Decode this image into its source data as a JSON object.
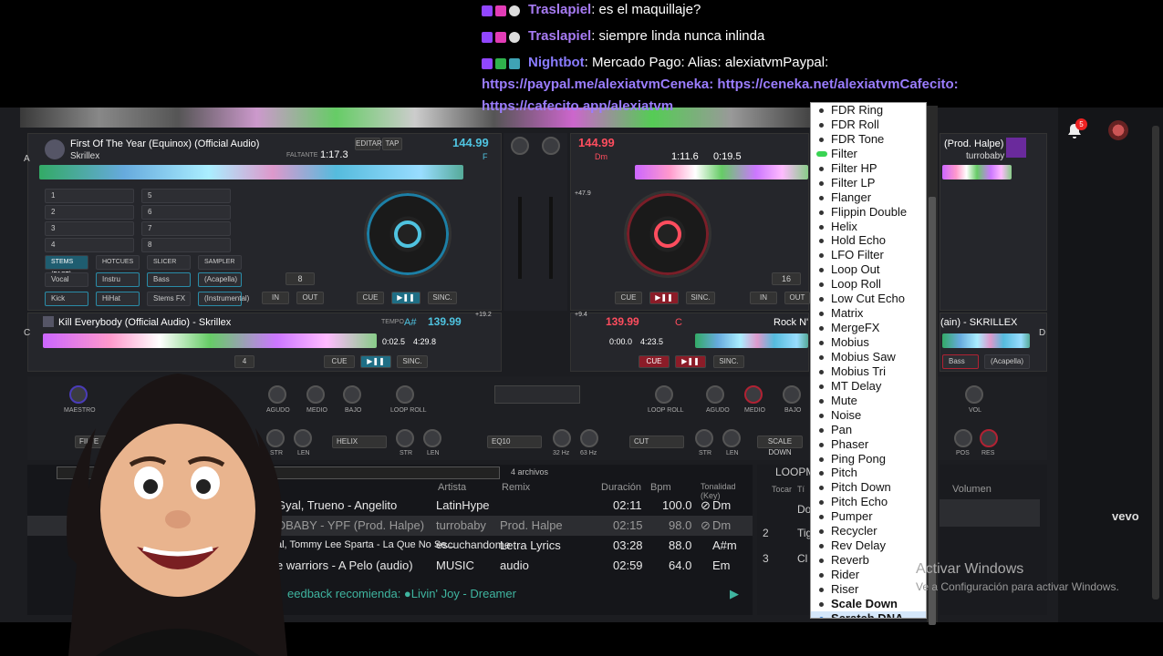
{
  "chat": {
    "messages": [
      {
        "user": "Traslapiel",
        "text": ": es el maquillaje?",
        "color": "#a77bf3"
      },
      {
        "user": "Traslapiel",
        "text": ": siempre linda nunca inlinda",
        "color": "#a77bf3"
      },
      {
        "user": "Nightbot",
        "text": ": Mercado Pago: Alias: alexiatvmPaypal:",
        "color": "#8a7cff"
      }
    ],
    "link1": "https://paypal.me/alexiatvmCeneka: https://ceneka.net/alexiatvmCafecito:",
    "link2": "https://cafecito.app/alexiatvm"
  },
  "deck_a": {
    "letter": "A",
    "title": "First Of The Year (Equinox) (Official Audio)",
    "artist": "Skrillex",
    "bpm": "144.99",
    "time": "1:17.3",
    "key": "F",
    "loop": "8",
    "buttons": {
      "cue": "CUE",
      "sync": "SINC.",
      "in": "IN",
      "out": "OUT",
      "edit": "EDITAR",
      "tap": "TAP",
      "remaining": "FALTANTE"
    },
    "pad_tabs": [
      "STEMS (FAST)",
      "HOTCUES",
      "SLICER",
      "SAMPLER"
    ],
    "stems": [
      "Vocal",
      "Instru",
      "Bass",
      "(Acapella)",
      "Kick",
      "HiHat",
      "Stems FX",
      "(Instrumental)"
    ],
    "hotcues": [
      "1",
      "2",
      "3",
      "4",
      "5",
      "6",
      "7",
      "8"
    ]
  },
  "deck_b": {
    "bpm": "144.99",
    "key": "Dm",
    "time_elapsed": "1:11.6",
    "time_remaining": "0:19.5",
    "title": "(Prod. Halpe)",
    "artist": "turrobaby",
    "loop": "16",
    "pitch": "+47.9"
  },
  "deck_c": {
    "letter": "C",
    "title": "Kill Everybody (Official Audio) - Skrillex",
    "key": "A#",
    "bpm": "139.99",
    "tempo_label": "TEMPO",
    "tempo": "0:02.5",
    "remaining": "4:29.8",
    "loop": "4",
    "pitch": "+19.2"
  },
  "deck_d": {
    "letter": "D",
    "title_left": "Rock N'",
    "title_right": "(ain) - SKRILLEX",
    "bpm": "139.99",
    "key": "C",
    "tempo": "0:00.0",
    "remaining": "4:23.5",
    "pitch": "+9.4",
    "stems": [
      "Bass",
      "(Acapella)"
    ]
  },
  "mixer": {
    "knobs": [
      "MAESTRO",
      "AGUDO",
      "MEDIO",
      "BAJO",
      "LOOP ROLL",
      "LOOP ROLL",
      "AGUDO",
      "MEDIO",
      "BAJO",
      "VOL"
    ],
    "fx": [
      "FILTE",
      "HELIX",
      "EQ10",
      "CUT",
      "SCALE DOWN"
    ],
    "fx_labels": [
      "STR",
      "LEN",
      "STR",
      "LEN",
      "32 Hz",
      "63 Hz",
      "STR",
      "LEN",
      "POS",
      "RES"
    ]
  },
  "browser": {
    "file_count": "4 archivos",
    "columns": [
      "Artista",
      "Remix",
      "Duración",
      "Bpm",
      "Tonalidad (Key)"
    ],
    "rows": [
      {
        "title": "Gyal, Trueno - Angelito",
        "artist": "LatinHype",
        "remix": "",
        "duration": "02:11",
        "bpm": "100.0",
        "key": "Dm",
        "highlight": false
      },
      {
        "title": "OBABY - YPF (Prod. Halpe)",
        "artist": "turrobaby",
        "remix": "Prod. Halpe",
        "duration": "02:15",
        "bpm": "98.0",
        "key": "Dm",
        "highlight": true
      },
      {
        "title": "al, Tommy Lee Sparta - La Que No Se...",
        "artist": "escuchandome",
        "remix": "Letra Lyrics",
        "duration": "03:28",
        "bpm": "88.0",
        "key": "A#m",
        "highlight": false
      },
      {
        "title": "e warriors - A Pelo (audio)",
        "artist": "MUSIC",
        "remix": "audio",
        "duration": "02:59",
        "bpm": "64.0",
        "key": "Em",
        "highlight": false
      }
    ],
    "suggestion": "eedback recomienda: ●Livin' Joy - Dreamer"
  },
  "loop_panel": {
    "title": "LOOPM",
    "header_play": "Tocar",
    "header_title": "Tí",
    "items": [
      "Do",
      "Tig",
      "Cl"
    ],
    "numbers": [
      "2",
      "3"
    ],
    "volume_label": "Volumen"
  },
  "fx_menu": {
    "items": [
      "FDR Ring",
      "FDR Roll",
      "FDR Tone",
      "Filter",
      "Filter HP",
      "Filter LP",
      "Flanger",
      "Flippin Double",
      "Helix",
      "Hold Echo",
      "LFO Filter",
      "Loop Out",
      "Loop Roll",
      "Low Cut Echo",
      "Matrix",
      "MergeFX",
      "Mobius",
      "Mobius Saw",
      "Mobius Tri",
      "MT Delay",
      "Mute",
      "Noise",
      "Pan",
      "Phaser",
      "Ping Pong",
      "Pitch",
      "Pitch Down",
      "Pitch Echo",
      "Pumper",
      "Recycler",
      "Rev Delay",
      "Reverb",
      "Rider",
      "Riser",
      "Scale Down",
      "Scratch DNA"
    ],
    "active": "Scratch DNA",
    "bold": "Scale Down",
    "selected_indicator": "Filter"
  },
  "notifications": {
    "count": "5"
  },
  "watermark": {
    "line1": "Activar Windows",
    "line2": "Ve a Configuración para activar Windows.",
    "brand": "vevo"
  },
  "colors": {
    "deck_blue": "#4fc3e0",
    "deck_red": "#ff4d5e",
    "accent_purple": "#9b7dff"
  }
}
